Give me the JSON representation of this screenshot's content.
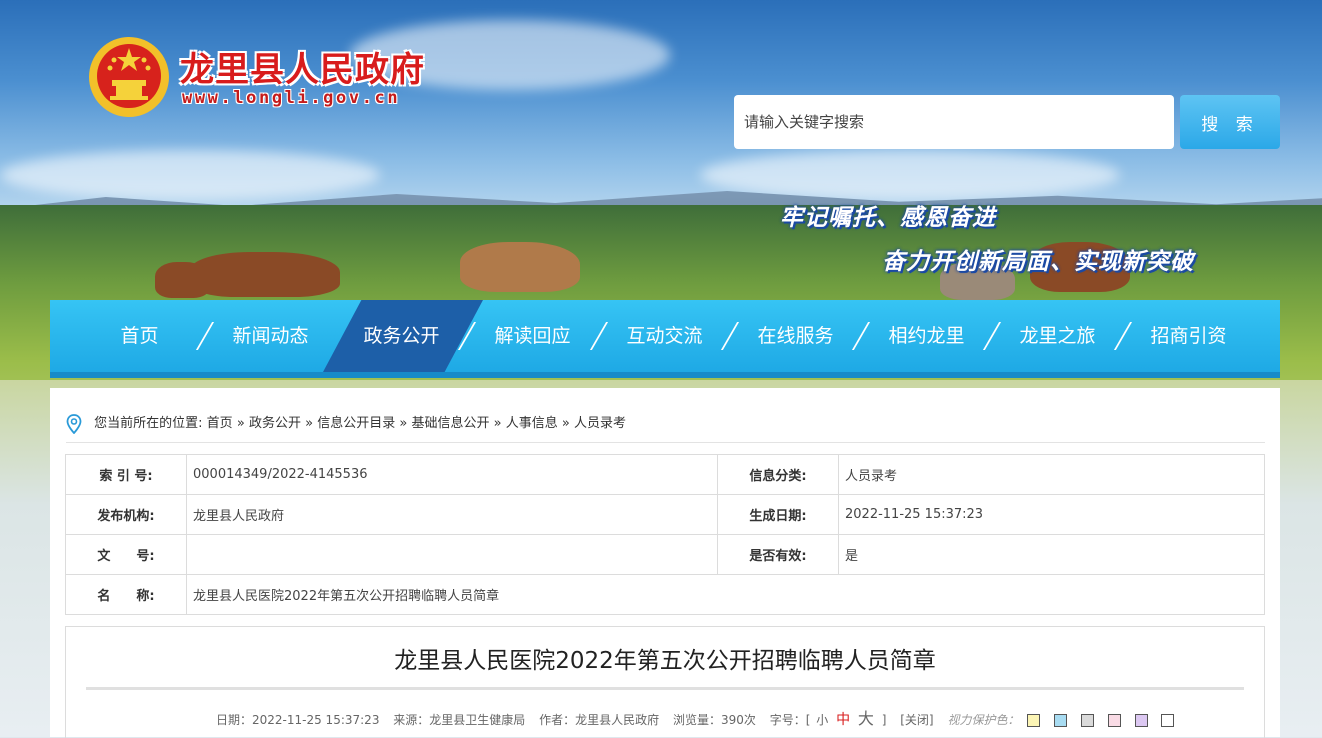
{
  "header": {
    "site_title": "龙里县人民政府",
    "site_url": "www.longli.gov.cn",
    "search_placeholder": "请输入关键字搜索",
    "search_button": "搜 索",
    "slogan_line1": "牢记嘱托、感恩奋进",
    "slogan_line2": "奋力开创新局面、实现新突破"
  },
  "nav": {
    "items": [
      {
        "label": "首页"
      },
      {
        "label": "新闻动态"
      },
      {
        "label": "政务公开",
        "active": true
      },
      {
        "label": "解读回应"
      },
      {
        "label": "互动交流"
      },
      {
        "label": "在线服务"
      },
      {
        "label": "相约龙里"
      },
      {
        "label": "龙里之旅"
      },
      {
        "label": "招商引资"
      }
    ]
  },
  "breadcrumb": {
    "prefix": "您当前所在的位置:",
    "items": [
      "首页",
      "政务公开",
      "信息公开目录",
      "基础信息公开",
      "人事信息",
      "人员录考"
    ],
    "separator": "»"
  },
  "meta": {
    "index_label": "索 引 号:",
    "index_value": "000014349/2022-4145536",
    "category_label": "信息分类:",
    "category_value": "人员录考",
    "publisher_label": "发布机构:",
    "publisher_value": "龙里县人民政府",
    "date_label": "生成日期:",
    "date_value": "2022-11-25 15:37:23",
    "docno_label": "文　　号:",
    "docno_value": "",
    "valid_label": "是否有效:",
    "valid_value": "是",
    "name_label": "名　　称:",
    "name_value": "龙里县人民医院2022年第五次公开招聘临聘人员简章"
  },
  "article": {
    "title": "龙里县人民医院2022年第五次公开招聘临聘人员简章",
    "date": "日期：2022-11-25 15:37:23",
    "source": "来源：龙里县卫生健康局",
    "author": "作者：龙里县人民政府",
    "views": "浏览量：390次",
    "font_label": "字号：[",
    "font_small": "小",
    "font_mid": "中",
    "font_big": "大",
    "font_close": "]",
    "close_label": "[关闭]",
    "eye_label": "视力保护色：",
    "eye_colors": [
      "#fcf5b5",
      "#a8dcf2",
      "#dadada",
      "#f9dbe5",
      "#dcc8f2",
      "#ffffff"
    ]
  }
}
